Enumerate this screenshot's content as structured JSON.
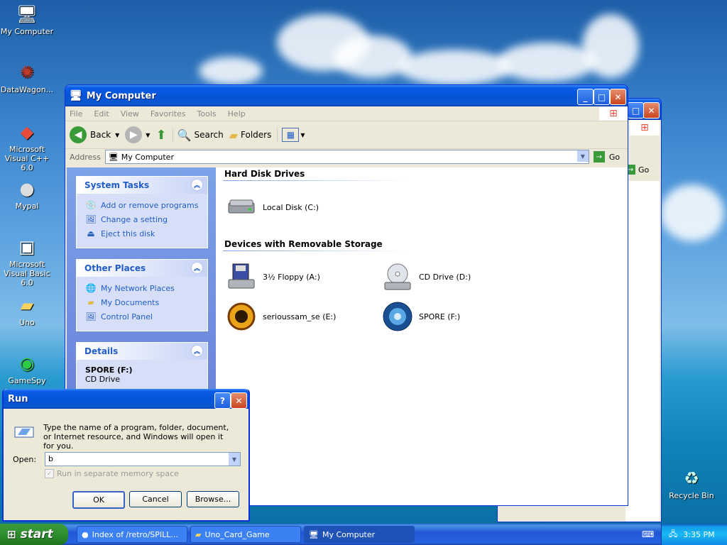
{
  "desktop": {
    "icons": [
      {
        "label": "My Computer"
      },
      {
        "label": "DataWagon..."
      },
      {
        "label": "Microsoft Visual C++ 6.0"
      },
      {
        "label": "Mypal"
      },
      {
        "label": "Microsoft Visual Basic 6.0"
      },
      {
        "label": "Uno"
      },
      {
        "label": "GameSpy"
      },
      {
        "label": "Recycle Bin"
      }
    ]
  },
  "explorer": {
    "title": "My Computer",
    "menu": [
      "File",
      "Edit",
      "View",
      "Favorites",
      "Tools",
      "Help"
    ],
    "toolbar": {
      "back": "Back",
      "search": "Search",
      "folders": "Folders"
    },
    "address_label": "Address",
    "address_value": "My Computer",
    "go": "Go",
    "system_tasks": {
      "title": "System Tasks",
      "items": [
        "Add or remove programs",
        "Change a setting",
        "Eject this disk"
      ]
    },
    "other_places": {
      "title": "Other Places",
      "items": [
        "My Network Places",
        "My Documents",
        "Control Panel"
      ]
    },
    "details": {
      "title": "Details",
      "name": "SPORE (F:)",
      "type": "CD Drive"
    },
    "sections": {
      "hdd": "Hard Disk Drives",
      "removable": "Devices with Removable Storage"
    },
    "drives": {
      "c": "Local Disk (C:)",
      "a": "3½ Floppy (A:)",
      "d": "CD Drive (D:)",
      "e": "serioussam_se (E:)",
      "f": "SPORE (F:)"
    }
  },
  "back_window": {
    "go": "Go"
  },
  "run": {
    "title": "Run",
    "description": "Type the name of a program, folder, document, or Internet resource, and Windows will open it for you.",
    "open_label": "Open:",
    "open_value": "b",
    "checkbox_label": "Run in separate memory space",
    "ok": "OK",
    "cancel": "Cancel",
    "browse": "Browse..."
  },
  "taskbar": {
    "start": "start",
    "tasks": [
      "Index of /retro/SPILL...",
      "Uno_Card_Game",
      "My Computer"
    ],
    "clock": "3:35 PM"
  }
}
